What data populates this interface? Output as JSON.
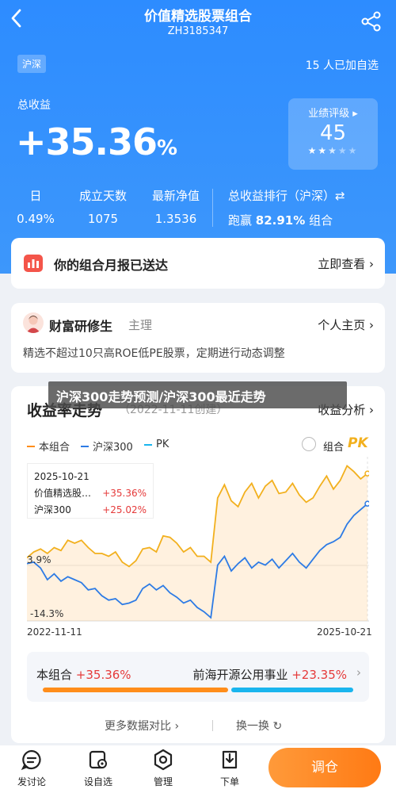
{
  "header": {
    "title": "价值精选股票组合",
    "code": "ZH3185347",
    "market_tag": "沪深",
    "followers": "15 人已加自选"
  },
  "summary": {
    "total_label": "总收益",
    "total_value": "+35.36",
    "total_unit": "%",
    "rating_label": "业绩评级 ▸",
    "rating_score": "45",
    "rating_stars": 2.5,
    "stats": [
      {
        "key": "日",
        "value": "0.49%"
      },
      {
        "key": "成立天数",
        "value": "1075"
      },
      {
        "key": "最新净值",
        "value": "1.3536"
      }
    ],
    "rank_label": "总收益排行（沪深）⇄",
    "rank_prefix": "跑赢",
    "rank_value": "82.91%",
    "rank_suffix": "组合"
  },
  "report": {
    "text": "你的组合月报已送达",
    "link": "立即查看 ›"
  },
  "author": {
    "name": "财富研修生",
    "role": "主理",
    "link": "个人主页 ›",
    "desc": "精选不超过10只高ROE低PE股票，定期进行动态调整"
  },
  "chart_section": {
    "title": "收益率走势",
    "created": "（2022-11-11创建）",
    "analysis": "收益分析 ›",
    "overlay": "沪深300走势预测/沪深300最近走势",
    "legend": [
      "本组合",
      "沪深300",
      "PK"
    ],
    "pk_label": "组合",
    "pk_badge": "PK",
    "tooltip": {
      "date": "2025-10-21",
      "row1_name": "价值精选股…",
      "row1_value": "+35.36%",
      "row2_name": "沪深300",
      "row2_value": "+25.02%"
    }
  },
  "chart_data": {
    "type": "line",
    "x_start": "2022-11-11",
    "x_end": "2025-10-21",
    "y_tick_labels": [
      "3.9%",
      "-14.3%"
    ],
    "ylim": [
      -14.3,
      40.0
    ],
    "series": [
      {
        "name": "本组合",
        "color": "#f2b01e",
        "values": [
          6.5,
          8.5,
          9.5,
          8.0,
          10.0,
          9.0,
          12.5,
          11.5,
          12.5,
          10.0,
          8.0,
          8.0,
          7.0,
          8.5,
          5.0,
          3.5,
          5.5,
          9.5,
          10.0,
          8.5,
          14.0,
          13.5,
          11.5,
          8.5,
          10.0,
          7.0,
          7.0,
          5.0,
          27.0,
          31.5,
          26.0,
          24.0,
          29.0,
          32.0,
          27.0,
          31.0,
          33.0,
          28.5,
          29.0,
          32.0,
          28.0,
          25.5,
          27.0,
          31.0,
          34.5,
          30.0,
          33.0,
          38.0,
          36.0,
          33.5,
          35.36
        ]
      },
      {
        "name": "沪深300",
        "color": "#2d7be5",
        "values": [
          4.5,
          5.0,
          3.0,
          -1.0,
          1.0,
          -1.5,
          0.0,
          -1.0,
          -2.0,
          -4.5,
          -4.0,
          -6.5,
          -8.0,
          -7.5,
          -9.5,
          -9.0,
          -8.0,
          -4.0,
          -2.5,
          -4.5,
          -3.0,
          -5.5,
          -7.0,
          -9.0,
          -8.0,
          -10.5,
          -12.0,
          -14.0,
          4.0,
          7.0,
          2.0,
          4.5,
          6.5,
          3.0,
          5.0,
          4.0,
          6.0,
          3.0,
          5.5,
          8.0,
          5.0,
          3.0,
          6.0,
          9.0,
          11.0,
          12.0,
          13.5,
          18.0,
          21.0,
          23.0,
          25.02
        ]
      }
    ]
  },
  "compare": {
    "a_label": "本组合",
    "a_value": "+35.36%",
    "b_label": "前海开源公用事业",
    "b_value": "+23.35%",
    "a_share": 0.6023
  },
  "footer": {
    "more": "更多数据对比 ›",
    "swap": "换一换 ↻",
    "nav": [
      "发讨论",
      "设自选",
      "管理",
      "下单"
    ],
    "primary": "调仓"
  },
  "colors": {
    "brand_blue": "#2d8cff",
    "orange": "#ff8d1a",
    "cyan": "#1ab5ee",
    "gold": "#f2b01e",
    "red": "#e53a3a"
  }
}
